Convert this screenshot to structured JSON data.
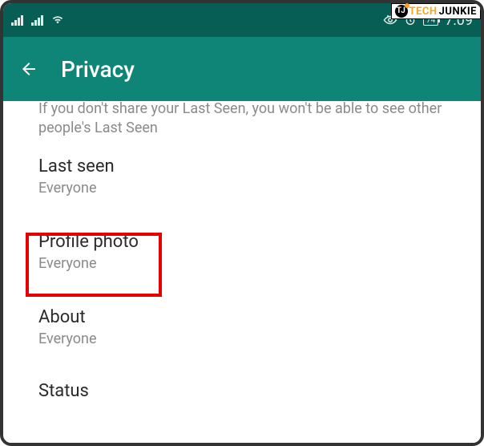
{
  "watermark": {
    "tech": "TECH",
    "junkie": "JUNKIE"
  },
  "statusbar": {
    "battery": "74",
    "time": "7:09"
  },
  "appbar": {
    "title": "Privacy"
  },
  "hint": "If you don't share your Last Seen, you won't be able to see other people's Last Seen",
  "settings": {
    "lastSeen": {
      "title": "Last seen",
      "value": "Everyone"
    },
    "profilePhoto": {
      "title": "Profile photo",
      "value": "Everyone"
    },
    "about": {
      "title": "About",
      "value": "Everyone"
    },
    "status": {
      "title": "Status"
    }
  }
}
